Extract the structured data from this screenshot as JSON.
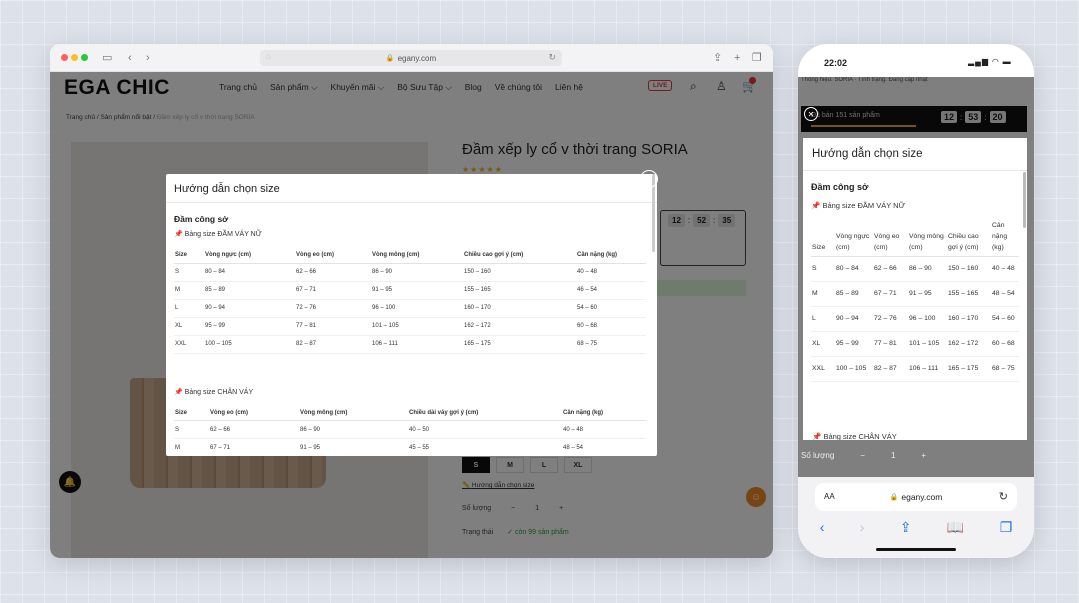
{
  "browser": {
    "url": "egany.com"
  },
  "site": {
    "logo": "EGA CHIC",
    "nav": [
      "Trang chủ",
      "Sản phẩm ⌵",
      "Khuyến mãi ⌵",
      "Bộ Sưu Tập ⌵",
      "Blog",
      "Về chúng tôi",
      "Liên hệ"
    ],
    "live_label": "LIVE",
    "breadcrumb": {
      "home": "Trang chủ",
      "sep": "/",
      "section": "Sản phẩm nổi bật",
      "current": "Đầm xếp ly cổ v thời trang SORIA"
    },
    "product_title": "Đầm xếp ly cổ v thời trang SORIA",
    "stars": "★★★★★",
    "timer": {
      "h": "12",
      "m": "52",
      "s": "35"
    },
    "sizes": [
      "S",
      "M",
      "L",
      "XL"
    ],
    "size_guide_link": "Hướng dẫn chọn size",
    "qty_label": "Số lượng",
    "qty_value": "1",
    "qty_minus": "−",
    "qty_plus": "+",
    "status_label": "Trạng thái",
    "status_value": "✓ còn 99 sản phẩm"
  },
  "modal": {
    "title": "Hướng dẫn chọn size",
    "section": "Đầm công sở",
    "table1_title": "Bảng size ĐẦM VÁY NỮ",
    "table1_headers": [
      "Size",
      "Vòng ngực (cm)",
      "Vòng eo (cm)",
      "Vòng mông (cm)",
      "Chiều cao gợi ý (cm)",
      "Cân nặng (kg)"
    ],
    "table1_rows": [
      [
        "S",
        "80 – 84",
        "62 – 66",
        "86 – 90",
        "150 – 160",
        "40 – 48"
      ],
      [
        "M",
        "85 – 89",
        "67 – 71",
        "91 – 95",
        "155 – 165",
        "46 – 54"
      ],
      [
        "L",
        "90 – 94",
        "72 – 76",
        "96 – 100",
        "160 – 170",
        "54 – 60"
      ],
      [
        "XL",
        "95 – 99",
        "77 – 81",
        "101 – 105",
        "162 – 172",
        "60 – 68"
      ],
      [
        "XXL",
        "100 – 105",
        "82 – 87",
        "106 – 111",
        "165 – 175",
        "68 – 75"
      ]
    ],
    "table2_title": "Bảng size CHÂN VÁY",
    "table2_headers": [
      "Size",
      "Vòng eo (cm)",
      "Vòng mông (cm)",
      "Chiều dài váy gợi ý (cm)",
      "Cân nặng (kg)"
    ],
    "table2_rows": [
      [
        "S",
        "62 – 66",
        "86 – 90",
        "40 – 50",
        "40 – 48"
      ],
      [
        "M",
        "67 – 71",
        "91 – 95",
        "45 – 55",
        "48 – 54"
      ]
    ]
  },
  "phone": {
    "time": "22:02",
    "signal": "▂▄▆ ◠ ▬",
    "top_text": "Thông hiệu: SORIA · Tình trạng: Đang cập nhật",
    "sold": "Đã bán 151 sản phẩm",
    "timer": {
      "h": "12",
      "m": "53",
      "s": "20"
    },
    "modal_title": "Hướng dẫn chọn size",
    "section": "Đầm công sở",
    "table1_title": "Bảng size ĐẦM VÁY NỮ",
    "table1_headers": [
      "Size",
      "Vòng ngực (cm)",
      "Vòng eo (cm)",
      "Vòng mông (cm)",
      "Chiều cao gợi ý (cm)",
      "Cân nặng (kg)"
    ],
    "table1_rows": [
      [
        "S",
        "80 – 84",
        "62 – 66",
        "86 – 90",
        "150 – 160",
        "40 – 48"
      ],
      [
        "M",
        "85 – 89",
        "67 – 71",
        "91 – 95",
        "155 – 165",
        "48 – 54"
      ],
      [
        "L",
        "90 – 94",
        "72 – 76",
        "96 – 100",
        "160 – 170",
        "54 – 60"
      ],
      [
        "XL",
        "95 – 99",
        "77 – 81",
        "101 – 105",
        "162 – 172",
        "60 – 68"
      ],
      [
        "XXL",
        "100 – 105",
        "82 – 87",
        "106 – 111",
        "165 – 175",
        "68 – 75"
      ]
    ],
    "table2_title": "Bảng size CHÂN VÁY",
    "qty_label": "Số lượng",
    "qty_minus": "−",
    "qty_value": "1",
    "qty_plus": "+",
    "url_aa": "AA",
    "url": "egany.com"
  }
}
